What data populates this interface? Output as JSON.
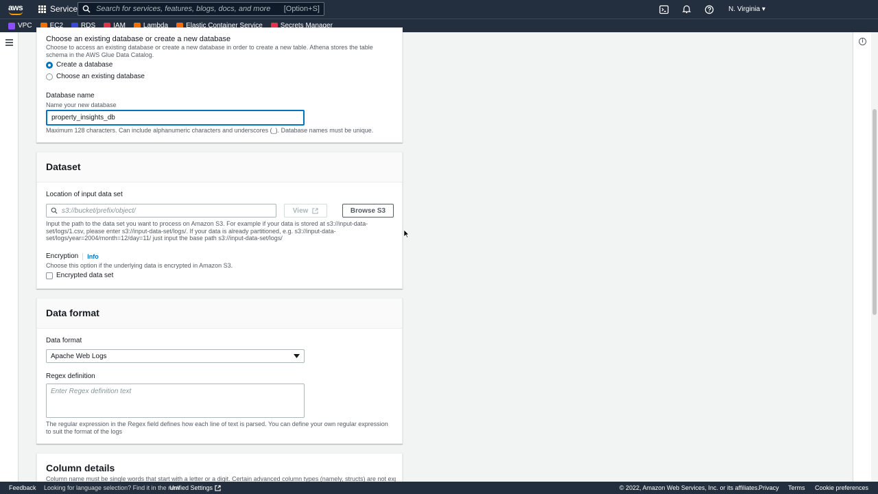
{
  "topnav": {
    "logo": "aws",
    "services_label": "Services",
    "search_placeholder": "Search for services, features, blogs, docs, and more",
    "search_shortcut": "[Option+S]",
    "region": "N. Virginia ▾"
  },
  "favorites": [
    {
      "label": "VPC",
      "color": "#8c4fff"
    },
    {
      "label": "EC2",
      "color": "#ed7100"
    },
    {
      "label": "RDS",
      "color": "#3b48cc"
    },
    {
      "label": "IAM",
      "color": "#dd344c"
    },
    {
      "label": "Lambda",
      "color": "#ed7100"
    },
    {
      "label": "Elastic Container Service",
      "color": "#ed7100"
    },
    {
      "label": "Secrets Manager",
      "color": "#dd344c"
    }
  ],
  "database": {
    "heading": "Choose an existing database or create a new database",
    "description": "Choose to access an existing database or create a new database in order to create a new table. Athena stores the table schema in the AWS Glue Data Catalog.",
    "option_create": "Create a database",
    "option_existing": "Choose an existing database",
    "selected": "Create a database",
    "name_label": "Database name",
    "name_hint": "Name your new database",
    "name_value": "property_insights_db",
    "name_constraint": "Maximum 128 characters. Can include alphanumeric characters and underscores (_). Database names must be unique."
  },
  "dataset": {
    "title": "Dataset",
    "location_label": "Location of input data set",
    "location_placeholder": "s3://bucket/prefix/object/",
    "view_button": "View",
    "browse_button": "Browse S3",
    "location_help": "Input the path to the data set you want to process on Amazon S3. For example if your data is stored at s3://input-data-set/logs/1.csv, please enter s3://input-data-set/logs/. If your data is already partitioned, e.g. s3://input-data-set/logs/year=2004/month=12/day=11/ just input the base path s3://input-data-set/logs/",
    "encryption_label": "Encryption",
    "encryption_info": "Info",
    "encryption_desc": "Choose this option if the underlying data is encrypted in Amazon S3.",
    "encrypted_checkbox": "Encrypted data set",
    "encrypted_checked": false
  },
  "data_format": {
    "title": "Data format",
    "format_label": "Data format",
    "format_value": "Apache Web Logs",
    "regex_label": "Regex definition",
    "regex_placeholder": "Enter Regex definition text",
    "regex_help": "The regular expression in the Regex field defines how each line of text is parsed. You can define your own regular expression to suit the format of the logs"
  },
  "column_details": {
    "title": "Column details",
    "desc": "Column name must be single words that start with a letter or a digit. Certain advanced column types (namely, structs) are not exposed in"
  },
  "footer": {
    "feedback": "Feedback",
    "language_text": "Looking for language selection? Find it in the new",
    "unified_settings": "Unified Settings",
    "copyright": "© 2022, Amazon Web Services, Inc. or its affiliates.",
    "privacy": "Privacy",
    "terms": "Terms",
    "cookie": "Cookie preferences"
  }
}
